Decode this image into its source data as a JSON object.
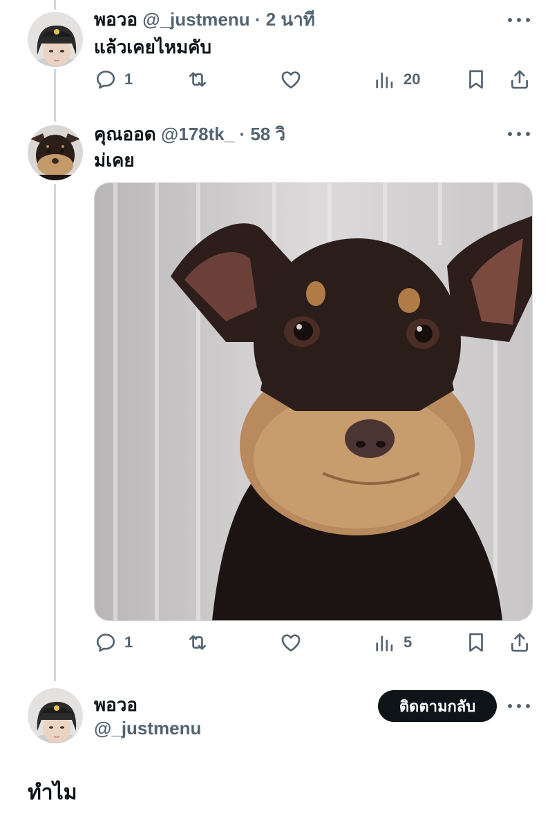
{
  "reply1": {
    "name": "พอวอ",
    "handle": "@_justmenu",
    "separator": "·",
    "time": "2 นาที",
    "text": "แล้วเคยไหมคับ",
    "replies": "1",
    "views": "20"
  },
  "reply2": {
    "name": "คุณออด",
    "handle": "@178tk_",
    "separator": "·",
    "time": "58 วิ",
    "text": "ม่เคย",
    "replies": "1",
    "views": "5"
  },
  "main_post": {
    "name": "พอวอ",
    "handle": "@_justmenu",
    "follow_label": "ติดตามกลับ",
    "text": "ทำไม"
  },
  "icons": {
    "reply": "reply-icon",
    "retweet": "retweet-icon",
    "like": "heart-icon",
    "views": "views-icon",
    "bookmark": "bookmark-icon",
    "share": "share-icon",
    "more": "more-icon"
  },
  "colors": {
    "text": "#0f1419",
    "secondary": "#536471",
    "thread_line": "#cfd9de",
    "button": "#0f1419"
  }
}
